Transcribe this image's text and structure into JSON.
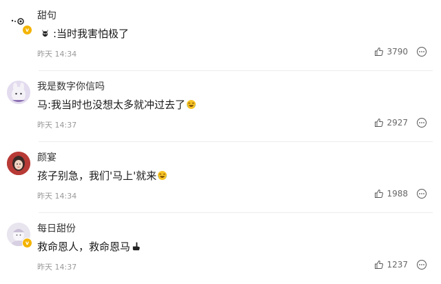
{
  "comments": [
    {
      "username": "甜句",
      "content": ":当时我害怕极了",
      "time": "昨天 14:34",
      "likes": "3790",
      "verified": true,
      "leading_emoji": "ghost-emoji-icon",
      "trailing_emoji": null
    },
    {
      "username": "我是数字你信吗",
      "content": "马:我当时也没想太多就冲过去了",
      "time": "昨天 14:37",
      "likes": "2927",
      "verified": false,
      "leading_emoji": null,
      "trailing_emoji": "laughing-tears-emoji-icon"
    },
    {
      "username": "颜宴",
      "content": "孩子别急，我们'马上'就来",
      "time": "昨天 14:34",
      "likes": "1988",
      "verified": false,
      "leading_emoji": null,
      "trailing_emoji": "laughing-tears-emoji-icon"
    },
    {
      "username": "每日甜份",
      "content": "救命恩人，救命恩马",
      "time": "昨天 14:37",
      "likes": "1237",
      "verified": true,
      "leading_emoji": null,
      "trailing_emoji": "pointing-hand-emoji-icon"
    }
  ],
  "colors": {
    "verified_badge": "#f4b400",
    "time_text": "#999999",
    "divider": "#ececec"
  }
}
